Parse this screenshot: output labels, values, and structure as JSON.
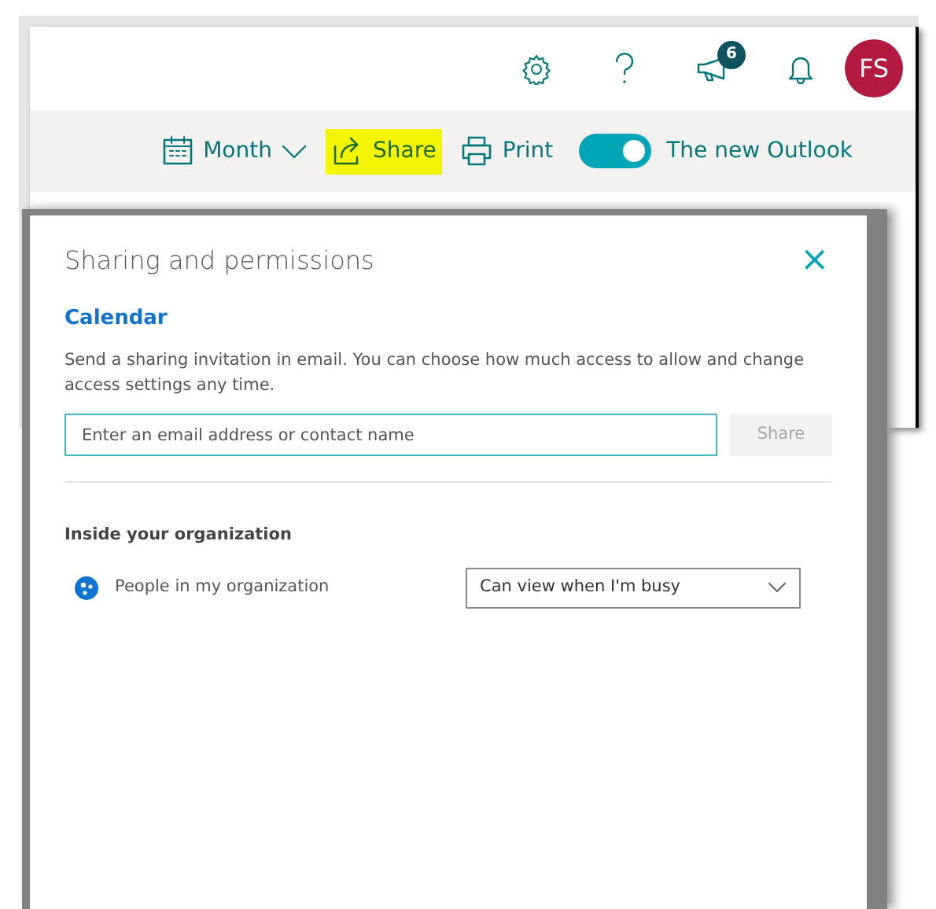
{
  "header": {
    "badge_count": "6",
    "avatar_initials": "FS"
  },
  "toolbar": [
    {
      "kind": "dropdown",
      "label": "Month",
      "highlighted": false
    },
    {
      "kind": "share",
      "label": "Share",
      "highlighted": true
    },
    {
      "kind": "print",
      "label": "Print",
      "highlighted": false
    },
    {
      "kind": "toggle",
      "label": "The new Outlook",
      "on": true,
      "highlighted": false
    }
  ],
  "dialog": {
    "title": "Sharing and permissions",
    "close": "×",
    "subtitle": "Calendar",
    "description": "Send a sharing invitation in email. You can choose how much access to allow and change access settings any time.",
    "email_field": {
      "placeholder": "Enter an email address or contact name"
    },
    "share_button": {
      "label": "Share",
      "disabled": true
    },
    "section_title": "Inside your organization",
    "permissions": [
      {
        "name": "People in my organization",
        "access": "Can view when I'm busy"
      }
    ]
  }
}
